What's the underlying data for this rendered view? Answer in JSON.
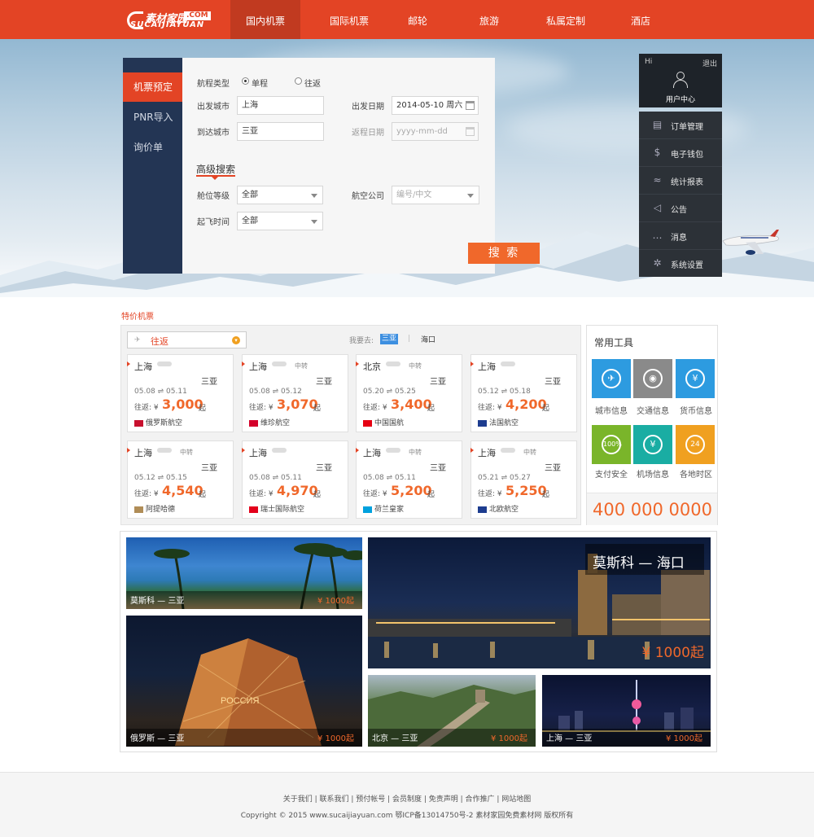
{
  "logo": {
    "main": "素材家园",
    "com": ".COM",
    "sub": "SUCAIJIAYUAN"
  },
  "nav": [
    "国内机票",
    "国际机票",
    "邮轮",
    "旅游",
    "私属定制",
    "酒店"
  ],
  "booking": {
    "tabs": [
      "机票预定",
      "PNR导入",
      "询价单"
    ],
    "trip_type_label": "航程类型",
    "trip_oneway": "单程",
    "trip_return": "往返",
    "depart_city_label": "出发城市",
    "depart_city": "上海",
    "arrive_city_label": "到达城市",
    "arrive_city": "三亚",
    "depart_date_label": "出发日期",
    "depart_date": "2014-05-10 周六",
    "return_date_label": "返程日期",
    "return_date_placeholder": "yyyy-mm-dd",
    "advanced": "高级搜索",
    "cabin_label": "舱位等级",
    "cabin": "全部",
    "airline_label": "航空公司",
    "airline_placeholder": "编号/中文",
    "time_label": "起飞时间",
    "time": "全部",
    "search": "搜 索"
  },
  "user": {
    "hi": "Hi",
    "logout": "退出",
    "center": "用户中心",
    "menu": [
      "订单管理",
      "电子钱包",
      "统计报表",
      "公告",
      "消息",
      "系统设置"
    ]
  },
  "deals": {
    "section_title": "特价机票",
    "trip": "往返",
    "want_to": "我要去:",
    "dest_active": "三亚",
    "dest_sep": "|",
    "dest_other": "海口",
    "cards": [
      {
        "from": "上海",
        "transfer": "",
        "to": "三亚",
        "dates": "05.08 ⇌ 05.11",
        "price_prefix": "往返: ¥",
        "price": "3,000",
        "suffix": "起",
        "airline": "俄罗斯航空"
      },
      {
        "from": "上海",
        "transfer": "中转",
        "to": "三亚",
        "dates": "05.08 ⇌ 05.12",
        "price_prefix": "往返: ¥",
        "price": "3,070",
        "suffix": "起",
        "airline": "维珍航空"
      },
      {
        "from": "北京",
        "transfer": "中转",
        "to": "三亚",
        "dates": "05.20 ⇌ 05.25",
        "price_prefix": "往返: ¥",
        "price": "3,400",
        "suffix": "起",
        "airline": "中国国航"
      },
      {
        "from": "上海",
        "transfer": "",
        "to": "三亚",
        "dates": "05.12 ⇌ 05.18",
        "price_prefix": "往返: ¥",
        "price": "4,200",
        "suffix": "起",
        "airline": "法国航空"
      },
      {
        "from": "上海",
        "transfer": "中转",
        "to": "三亚",
        "dates": "05.12 ⇌ 05.15",
        "price_prefix": "往返: ¥",
        "price": "4,540",
        "suffix": "起",
        "airline": "阿提哈德"
      },
      {
        "from": "上海",
        "transfer": "",
        "to": "三亚",
        "dates": "05.08 ⇌ 05.11",
        "price_prefix": "往返: ¥",
        "price": "4,970",
        "suffix": "起",
        "airline": "瑞士国际航空"
      },
      {
        "from": "上海",
        "transfer": "中转",
        "to": "三亚",
        "dates": "05.08 ⇌ 05.11",
        "price_prefix": "往返: ¥",
        "price": "5,200",
        "suffix": "起",
        "airline": "荷兰皇家"
      },
      {
        "from": "上海",
        "transfer": "中转",
        "to": "三亚",
        "dates": "05.21 ⇌ 05.27",
        "price_prefix": "往返: ¥",
        "price": "5,250",
        "suffix": "起",
        "airline": "北欧航空"
      }
    ]
  },
  "tools": {
    "title": "常用工具",
    "items": [
      {
        "label": "城市信息",
        "color": "#2d9be0",
        "icon": "city-icon"
      },
      {
        "label": "交通信息",
        "color": "#8a8a8a",
        "icon": "piggy-icon"
      },
      {
        "label": "货币信息",
        "color": "#2d9be0",
        "icon": "umbrella-icon"
      },
      {
        "label": "支付安全",
        "color": "#7ab52a",
        "icon": "shield-icon"
      },
      {
        "label": "机场信息",
        "color": "#1aada3",
        "icon": "coin-icon"
      },
      {
        "label": "各地时区",
        "color": "#f0a020",
        "icon": "clock-icon"
      }
    ],
    "phone": "400 000 0000"
  },
  "gallery": [
    {
      "name": "莫斯科 — 三亚",
      "price": "¥ 1000起"
    },
    {
      "name": "俄罗斯 — 三亚",
      "price": "¥ 1000起"
    },
    {
      "name": "莫斯科 — 海口",
      "price": "¥ 1000起"
    },
    {
      "name": "北京 — 三亚",
      "price": "¥ 1000起"
    },
    {
      "name": "上海 — 三亚",
      "price": "¥ 1000起"
    }
  ],
  "footer": {
    "links": "关于我们 | 联系我们 | 预付帐号 | 会员制度 | 免责声明 | 合作推广 | 网站地图",
    "copyright": "Copyright © 2015 www.sucaijiayuan.com 鄂ICP备13014750号-2 素材家园免费素材网 版权所有"
  }
}
